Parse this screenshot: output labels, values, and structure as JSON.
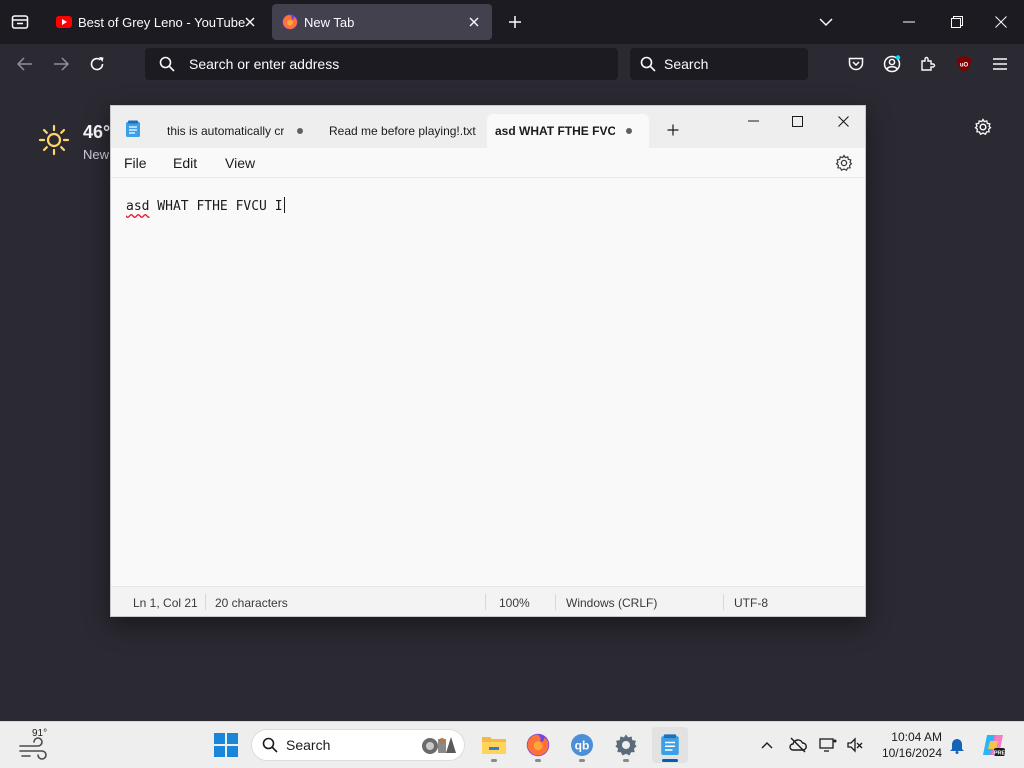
{
  "browser": {
    "tabs": [
      {
        "title": "Best of Grey Leno - YouTube",
        "icon": "youtube-icon",
        "active": false
      },
      {
        "title": "New Tab",
        "icon": "firefox-icon",
        "active": true
      }
    ],
    "urlbar_placeholder": "Search or enter address",
    "searchbar_placeholder": "Search",
    "ublock_badge": "uO"
  },
  "newtab": {
    "weather_temp": "46°",
    "weather_location": "New"
  },
  "notepad": {
    "tabs": [
      {
        "title": "this is automatically cr",
        "unsaved": true
      },
      {
        "title": "Read me before playing!.txt",
        "unsaved": false
      },
      {
        "title": "asd WHAT FTHE FVCU",
        "unsaved": true,
        "active": true
      }
    ],
    "menu": {
      "file": "File",
      "edit": "Edit",
      "view": "View"
    },
    "content": {
      "misspelled": "asd",
      "rest": " WHAT FTHE FVCU I"
    },
    "status": {
      "position": "Ln 1, Col 21",
      "characters": "20 characters",
      "zoom": "100%",
      "line_ending": "Windows (CRLF)",
      "encoding": "UTF-8"
    }
  },
  "taskbar": {
    "weather_temp": "91°",
    "search_placeholder": "Search",
    "time": "10:04 AM",
    "date": "10/16/2024",
    "apps": [
      "file-explorer-icon",
      "firefox-icon",
      "qbittorrent-icon",
      "settings-icon",
      "notepad-icon"
    ]
  }
}
